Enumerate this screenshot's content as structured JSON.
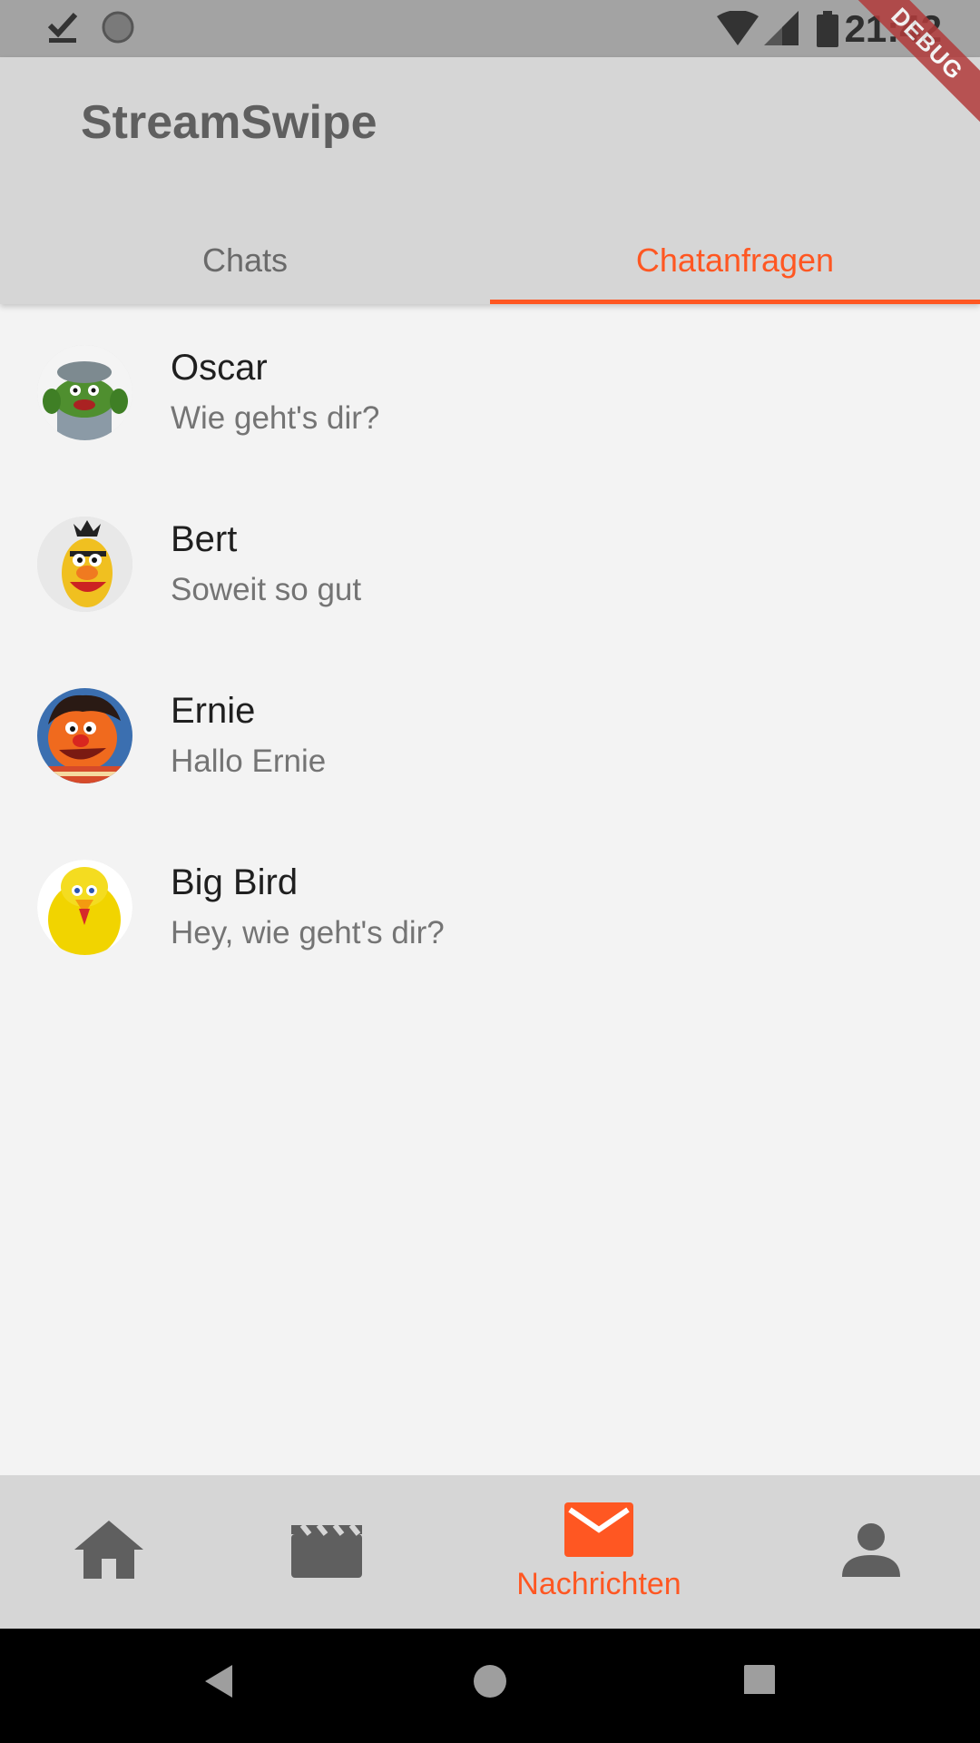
{
  "status_bar": {
    "time": "21:42",
    "icons": [
      "download-done-icon",
      "sync-icon",
      "wifi-icon",
      "signal-icon",
      "battery-icon"
    ]
  },
  "debug_banner": "DEBUG",
  "app": {
    "title": "StreamSwipe",
    "accent_color": "#ff5722"
  },
  "tabs": [
    {
      "label": "Chats",
      "active": false
    },
    {
      "label": "Chatanfragen",
      "active": true
    }
  ],
  "chats": [
    {
      "name": "Oscar",
      "message": "Wie geht's dir?",
      "avatar": "oscar-avatar"
    },
    {
      "name": "Bert",
      "message": "Soweit so gut",
      "avatar": "bert-avatar"
    },
    {
      "name": "Ernie",
      "message": "Hallo Ernie",
      "avatar": "ernie-avatar"
    },
    {
      "name": "Big Bird",
      "message": "Hey, wie geht's dir?",
      "avatar": "big-bird-avatar"
    }
  ],
  "bottom_nav": {
    "items": [
      {
        "icon": "home-icon",
        "label": ""
      },
      {
        "icon": "movie-icon",
        "label": ""
      },
      {
        "icon": "mail-icon",
        "label": "Nachrichten",
        "active": true
      },
      {
        "icon": "person-icon",
        "label": ""
      }
    ]
  },
  "system_nav": [
    "back-icon",
    "home-circle-icon",
    "recents-icon"
  ]
}
